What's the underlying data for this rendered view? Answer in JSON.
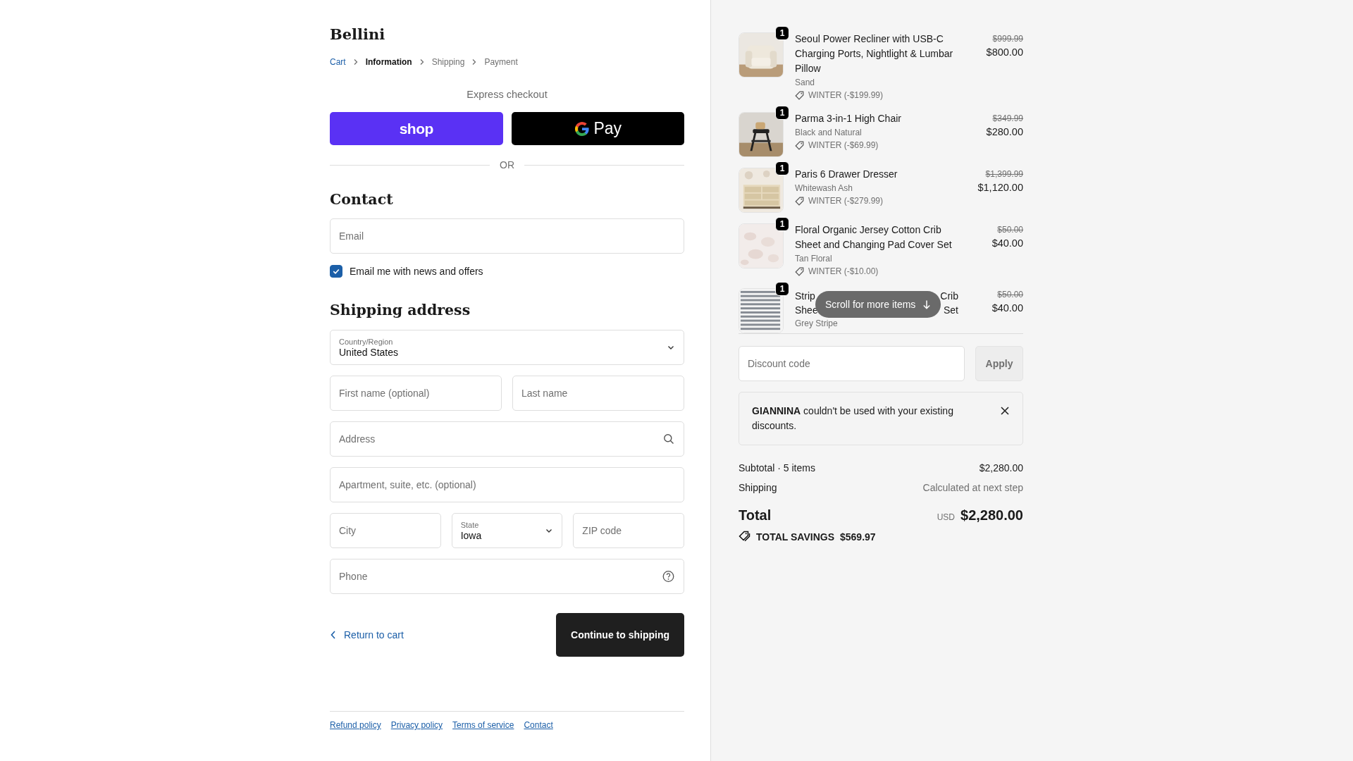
{
  "store": {
    "name": "Bellini"
  },
  "breadcrumbs": [
    {
      "label": "Cart",
      "kind": "link"
    },
    {
      "label": "Information",
      "kind": "current"
    },
    {
      "label": "Shipping",
      "kind": "step"
    },
    {
      "label": "Payment",
      "kind": "step"
    }
  ],
  "express_checkout": {
    "title": "Express checkout",
    "buttons": [
      {
        "kind": "shop",
        "label": "shop"
      },
      {
        "kind": "gpay",
        "label": "Pay"
      }
    ],
    "divider": "OR"
  },
  "contact": {
    "heading": "Contact",
    "email": {
      "placeholder": "Email"
    },
    "newsletter": {
      "label": "Email me with news and offers",
      "checked": true
    }
  },
  "shipping_address": {
    "heading": "Shipping address",
    "rows": [
      [
        {
          "kind": "select",
          "label": "Country/Region",
          "value": "United States"
        }
      ],
      [
        {
          "kind": "text",
          "placeholder": "First name (optional)"
        },
        {
          "kind": "text",
          "placeholder": "Last name"
        }
      ],
      [
        {
          "kind": "search",
          "placeholder": "Address"
        }
      ],
      [
        {
          "kind": "text",
          "placeholder": "Apartment, suite, etc. (optional)"
        }
      ],
      [
        {
          "kind": "text",
          "placeholder": "City"
        },
        {
          "kind": "select",
          "label": "State",
          "value": "Iowa"
        },
        {
          "kind": "text",
          "placeholder": "ZIP code"
        }
      ],
      [
        {
          "kind": "help",
          "placeholder": "Phone"
        }
      ]
    ]
  },
  "actions": {
    "back_link": "Return to cart",
    "continue_button": "Continue to shipping"
  },
  "footer_links": [
    "Refund policy",
    "Privacy policy",
    "Terms of service",
    "Contact"
  ],
  "order_summary": {
    "items": [
      {
        "quantity": "1",
        "title": "Seoul Power Recliner with USB-C Charging Ports, Nightlight & Lumbar Pillow",
        "variant": "Sand",
        "discount": "WINTER (-$199.99)",
        "compare_price": "$999.99",
        "price": "$800.00"
      },
      {
        "quantity": "1",
        "title": "Parma 3-in-1 High Chair",
        "variant": "Black and Natural",
        "discount": "WINTER (-$69.99)",
        "compare_price": "$349.99",
        "price": "$280.00"
      },
      {
        "quantity": "1",
        "title": "Paris 6 Drawer Dresser",
        "variant": "Whitewash Ash",
        "discount": "WINTER (-$279.99)",
        "compare_price": "$1,399.99",
        "price": "$1,120.00"
      },
      {
        "quantity": "1",
        "title": "Floral Organic Jersey Cotton Crib Sheet and Changing Pad Cover Set",
        "variant": "Tan Floral",
        "discount": "WINTER (-$10.00)",
        "compare_price": "$50.00",
        "price": "$40.00"
      },
      {
        "quantity": "1",
        "title_lines": [
          [
            "Strip",
            "Crib"
          ],
          [
            "Shee",
            "Set"
          ]
        ],
        "variant": "Grey Stripe",
        "compare_price": "$50.00",
        "price": "$40.00"
      }
    ],
    "scroll_hint": "Scroll for more items",
    "discount": {
      "placeholder": "Discount code",
      "button": "Apply"
    },
    "alert": "**GIANNINA** couldn't be used with your existing discounts.",
    "subtotal": {
      "label": "Subtotal · 5 items",
      "value": "$2,280.00"
    },
    "shipping": {
      "label": "Shipping",
      "value": "Calculated at next step"
    },
    "total": {
      "label": "Total",
      "currency": "USD",
      "value": "$2,280.00"
    },
    "savings": {
      "label": "TOTAL SAVINGS",
      "value": "$569.97"
    }
  }
}
